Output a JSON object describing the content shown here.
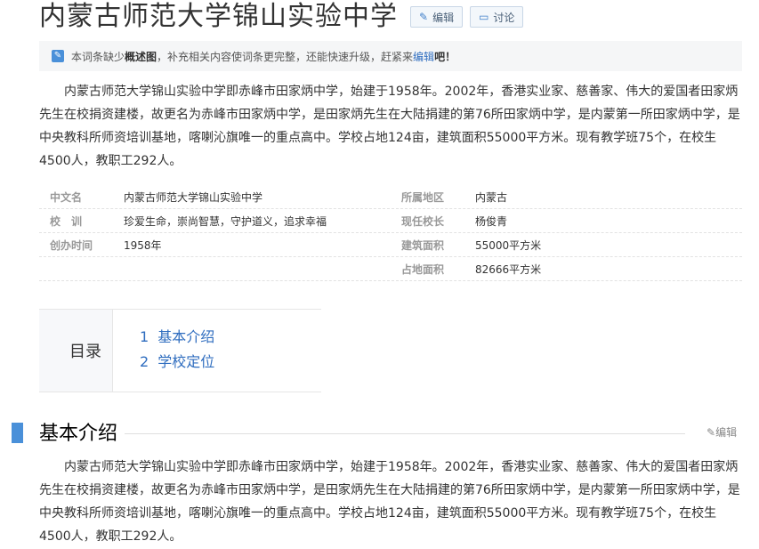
{
  "header": {
    "title": "内蒙古师范大学锦山实验中学",
    "edit_label": "编辑",
    "discuss_label": "讨论"
  },
  "notice": {
    "text_before": "本词条缺少",
    "bold": "概述图",
    "text_middle": "，补充相关内容使词条更完整，还能快速升级，赶紧来",
    "link": "编辑",
    "text_after": "吧！"
  },
  "summary": "内蒙古师范大学锦山实验中学即赤峰市田家炳中学，始建于1958年。2002年，香港实业家、慈善家、伟大的爱国者田家炳先生在校捐资建楼，故更名为赤峰市田家炳中学，是田家炳先生在大陆捐建的第76所田家炳中学，是内蒙第一所田家炳中学，是中央教科所师资培训基地，喀喇沁旗唯一的重点高中。学校占地124亩，建筑面积55000平方米。现有教学班75个，在校生4500人，教职工292人。",
  "infobox": {
    "rows": [
      {
        "left_key": "中文名",
        "left_val": "内蒙古师范大学锦山实验中学",
        "right_key": "所属地区",
        "right_val": "内蒙古"
      },
      {
        "left_key": "校　训",
        "left_val": "珍爱生命，崇尚智慧，守护道义，追求幸福",
        "right_key": "现任校长",
        "right_val": "杨俊青"
      },
      {
        "left_key": "创办时间",
        "left_val": "1958年",
        "right_key": "建筑面积",
        "right_val": "55000平方米"
      },
      {
        "left_key": "",
        "left_val": "",
        "right_key": "占地面积",
        "right_val": "82666平方米"
      }
    ]
  },
  "toc": {
    "label": "目录",
    "items": [
      {
        "num": "1",
        "label": "基本介绍"
      },
      {
        "num": "2",
        "label": "学校定位"
      }
    ]
  },
  "section": {
    "title": "基本介绍",
    "edit_label": "编辑",
    "body": "内蒙古师范大学锦山实验中学即赤峰市田家炳中学，始建于1958年。2002年，香港实业家、慈善家、伟大的爱国者田家炳先生在校捐资建楼，故更名为赤峰市田家炳中学，是田家炳先生在大陆捐建的第76所田家炳中学，是内蒙第一所田家炳中学，是中央教科所师资培训基地，喀喇沁旗唯一的重点高中。学校占地124亩，建筑面积55000平方米。现有教学班75个，在校生4500人，教职工292人。"
  },
  "icons": {
    "edit": "pencil-icon",
    "discuss": "chat-bubble-icon",
    "notice": "edit-note-icon"
  }
}
